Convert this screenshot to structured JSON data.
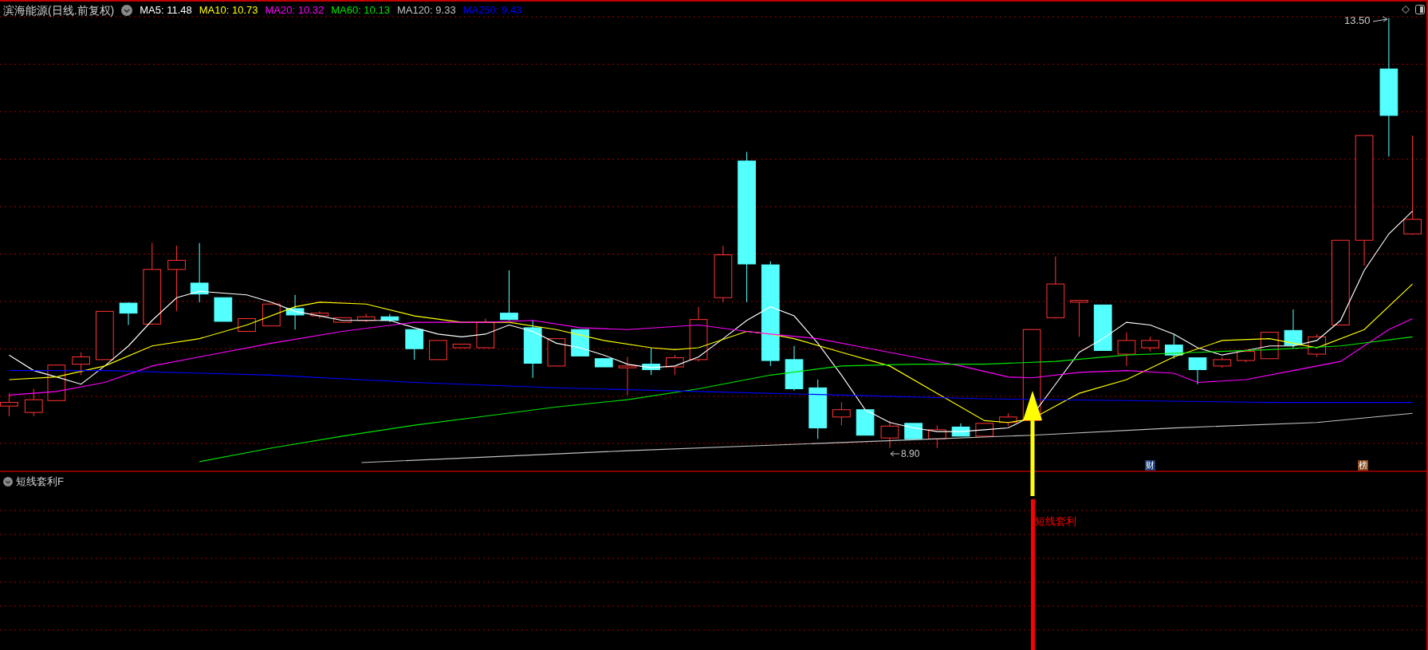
{
  "main_panel": {
    "title": "滨海能源(日线.前复权)",
    "moving_averages": [
      {
        "label": "MA5: 11.48",
        "color": "#ffffff"
      },
      {
        "label": "MA10: 10.73",
        "color": "#ffff00"
      },
      {
        "label": "MA20: 10.32",
        "color": "#ff00ff"
      },
      {
        "label": "MA60: 10.13",
        "color": "#00e600"
      },
      {
        "label": "MA120: 9.33",
        "color": "#c0c0c0"
      },
      {
        "label": "MA250: 9.43",
        "color": "#0000ff"
      }
    ],
    "high_marker": "13.50",
    "low_marker": "8.90",
    "event_badges": [
      {
        "label": "财",
        "color": "#1c3f7a"
      },
      {
        "label": "榜",
        "color": "#8a4a1c"
      }
    ]
  },
  "indicator_panel": {
    "title": "短线套利F",
    "signal_label": "短线套利"
  }
}
